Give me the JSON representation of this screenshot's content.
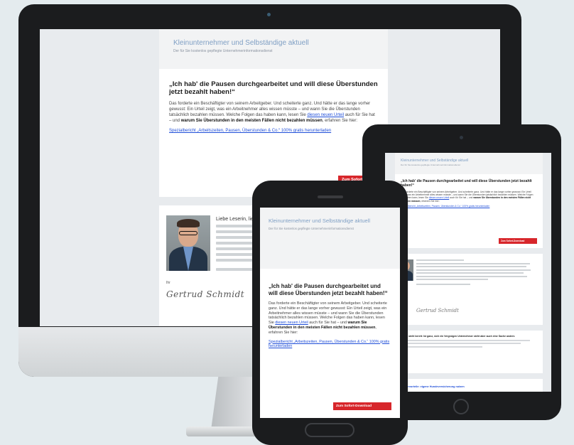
{
  "email": {
    "brand_title": "Kleinunternehmer und Selbständige aktuell",
    "brand_subtitle": "Der für Sie kostenlos gepflegte Unternehmerinformationsdienst",
    "date": "",
    "headline": "„Ich hab' die Pausen durchgearbeitet und will diese Überstunden jetzt bezahlt haben!“",
    "paragraph_intro": "Das forderte ein Beschäftigter von seinem Arbeitgeber. Und scheiterte ganz. Und hätte er das lange vorher gewusst: Ein Urteil zeigt, was ein Arbeitnehmer alles wissen müsste – und wann Sie die Überstunden tatsächlich bezahlen müssen. Welche Folgen das haben kann, lesen Sie",
    "paragraph_link": "diesen neuen Urteil",
    "paragraph_mid": "auch für Sie hat – und",
    "paragraph_bold": "warum Sie Überstunden in den meisten Fällen nicht bezahlen müssen",
    "paragraph_end": ", erfahren Sie hier:",
    "special_link": "Spezialbericht „Arbeitszeiten, Pausen, Überstunden & Co.“ 100% gratis herunterladen",
    "cta_button": "Zum Sofort-Download",
    "greeting": "Liebe Leserin, lieber Leser,",
    "signature_label": "Ihr",
    "signature": "Gertrud Schmidt",
    "tablet_lower_heading": "Arbeit steht bereit: Ist ganz, sich ein Vergnügen Unternehmer steht aber auch eine Sache anders",
    "tablet_lower_link": "Steuervorteile: eigene Hundeversicherung nutzen"
  }
}
